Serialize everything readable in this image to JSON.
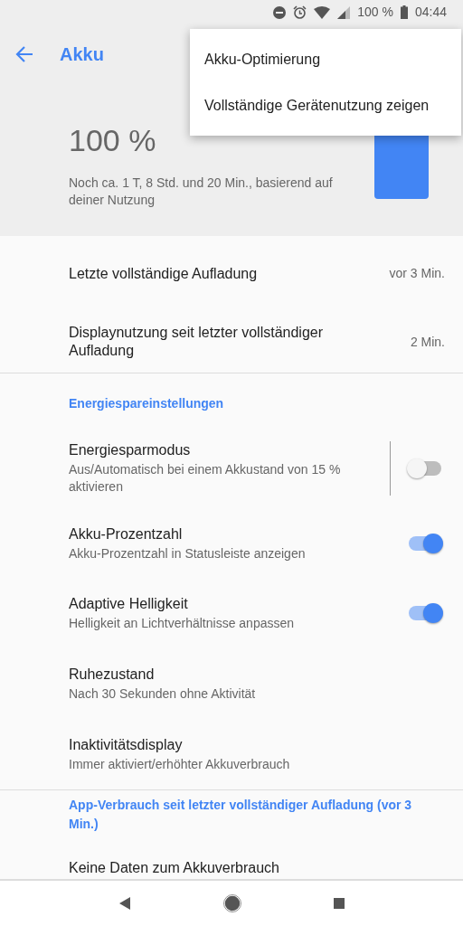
{
  "status_bar": {
    "battery_text": "100 %",
    "time": "04:44"
  },
  "app_bar": {
    "title": "Akku"
  },
  "menu": {
    "items": [
      "Akku-Optimierung",
      "Vollständige Gerätenutzung zeigen"
    ]
  },
  "battery": {
    "percent": "100 %",
    "estimate": "Noch ca. 1 T, 8 Std. und 20 Min., basierend auf deiner Nutzung"
  },
  "sections": [
    {
      "items": [
        {
          "kind": "value",
          "title": "Letzte vollständige Aufladung",
          "value": "vor 3 Min."
        },
        {
          "kind": "value",
          "title": "Displaynutzung seit letzter vollständiger Aufladung",
          "value": "2 Min."
        }
      ]
    },
    {
      "header": "Energiespareinstellungen",
      "items": [
        {
          "kind": "toggle",
          "title": "Energiesparmodus",
          "subtitle": "Aus/Automatisch bei einem Akkustand von 15 % aktivieren",
          "on": false,
          "divider": true
        },
        {
          "kind": "toggle",
          "title": "Akku-Prozentzahl",
          "subtitle": "Akku-Prozentzahl in Statusleiste anzeigen",
          "on": true
        },
        {
          "kind": "toggle",
          "title": "Adaptive Helligkeit",
          "subtitle": "Helligkeit an Lichtverhältnisse anpassen",
          "on": true
        },
        {
          "kind": "text",
          "title": "Ruhezustand",
          "subtitle": "Nach 30 Sekunden ohne Aktivität"
        },
        {
          "kind": "text",
          "title": "Inaktivitätsdisplay",
          "subtitle": "Immer aktiviert/erhöhter Akkuverbrauch"
        }
      ]
    },
    {
      "header": "App-Verbrauch seit letzter vollständiger Aufladung (vor 3 Min.)",
      "items": [
        {
          "kind": "text",
          "title": "Keine Daten zum Akkuverbrauch"
        }
      ]
    }
  ]
}
